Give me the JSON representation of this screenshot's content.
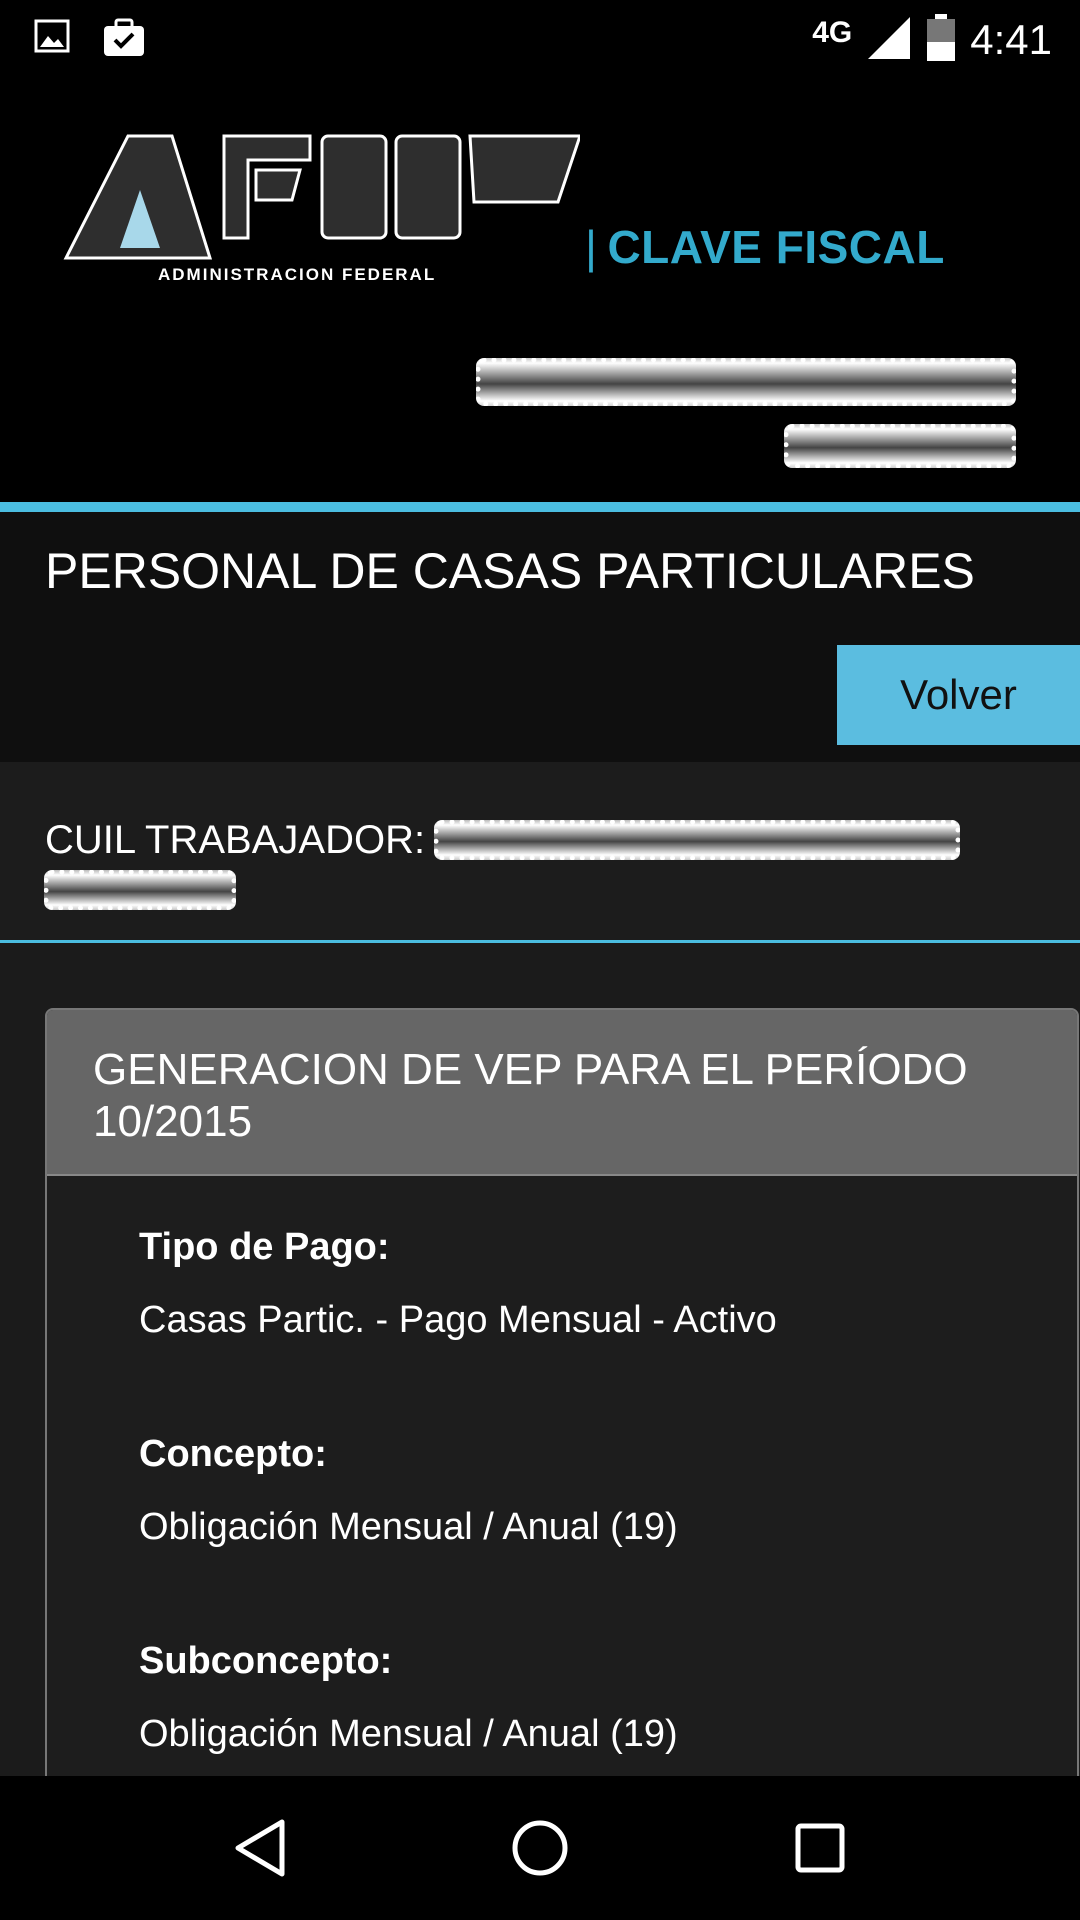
{
  "status_bar": {
    "time": "4:41",
    "network": "4G",
    "icons": [
      "image-icon",
      "briefcase-check-icon",
      "signal-icon",
      "battery-icon"
    ]
  },
  "header": {
    "logo_text": "ADMINISTRACION FEDERAL",
    "brand_separator": "|",
    "brand_label": "CLAVE FISCAL"
  },
  "page": {
    "title": "PERSONAL DE CASAS PARTICULARES",
    "back_button": "Volver"
  },
  "worker": {
    "cuil_label": "CUIL TRABAJADOR:"
  },
  "panel": {
    "title": "GENERACION DE VEP PARA EL PERÍODO 10/2015",
    "fields": [
      {
        "label": "Tipo de Pago:",
        "value": "Casas Partic. - Pago Mensual - Activo"
      },
      {
        "label": "Concepto:",
        "value": "Obligación Mensual / Anual (19)"
      },
      {
        "label": "Subconcepto:",
        "value": "Obligación Mensual / Anual (19)"
      }
    ]
  },
  "colors": {
    "accent": "#4bbde0",
    "brand": "#33aacc",
    "button_bg": "#5bbde0"
  }
}
